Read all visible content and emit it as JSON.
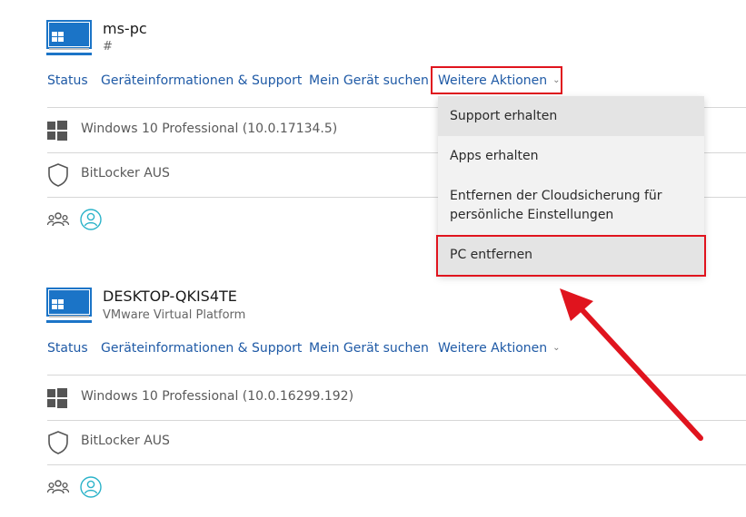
{
  "devices": [
    {
      "name": "ms-pc",
      "subtitle": "#",
      "actions": {
        "status": "Status",
        "device_info": "Geräteinformationen & Support",
        "find_device": "Mein Gerät suchen",
        "more_actions": "Weitere Aktionen"
      },
      "os": "Windows 10 Professional (10.0.17134.5)",
      "bitlocker": "BitLocker AUS"
    },
    {
      "name": "DESKTOP-QKIS4TE",
      "subtitle": "VMware Virtual Platform",
      "actions": {
        "status": "Status",
        "device_info": "Geräteinformationen & Support",
        "find_device": "Mein Gerät suchen",
        "more_actions": "Weitere Aktionen"
      },
      "os": "Windows 10 Professional (10.0.16299.192)",
      "bitlocker": "BitLocker AUS"
    }
  ],
  "dropdown": {
    "items": [
      {
        "label": "Support erhalten"
      },
      {
        "label": "Apps erhalten"
      },
      {
        "label": "Entfernen der Cloudsicherung für persönliche Einstellungen"
      },
      {
        "label": "PC entfernen"
      }
    ]
  },
  "colors": {
    "link": "#1f5aa6",
    "highlight": "#e0141e",
    "device_icon": "#1b74c7",
    "accent_teal": "#2bb3c9"
  },
  "icons": {
    "device": "monitor-icon",
    "os": "windows-logo-icon",
    "bitlocker": "shield-icon",
    "family": "group-icon",
    "account": "user-icon"
  }
}
